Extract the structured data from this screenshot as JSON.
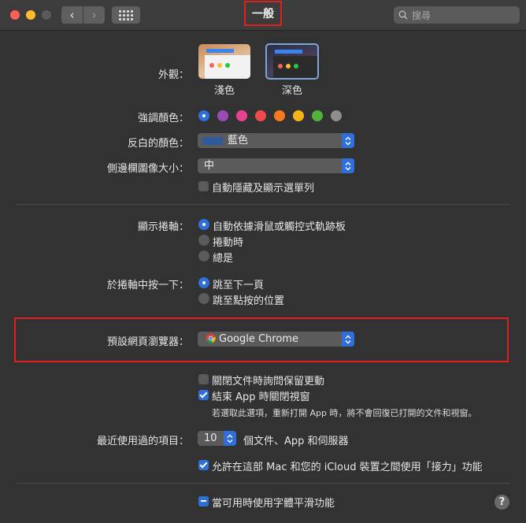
{
  "window": {
    "title": "一般",
    "search_placeholder": "搜尋"
  },
  "appearance": {
    "label": "外觀：",
    "options": [
      "淺色",
      "深色"
    ],
    "selected": "深色"
  },
  "accent": {
    "label": "強調顏色：",
    "colors": [
      "#2f6fdc",
      "#9b4bb5",
      "#e8418f",
      "#f04a4a",
      "#f57a1f",
      "#f6b21b",
      "#52b33a",
      "#8e8e8e"
    ],
    "selected_index": 0
  },
  "highlight": {
    "label": "反白的顏色：",
    "value": "藍色",
    "color": "#2f5a9a"
  },
  "sidebar_icon": {
    "label": "側邊欄圖像大小：",
    "value": "中"
  },
  "auto_hide_menu": {
    "label": "自動隱藏及顯示選單列",
    "checked": false
  },
  "scrollbars": {
    "label": "顯示捲軸：",
    "options": [
      "自動依據滑鼠或觸控式軌跡板",
      "捲動時",
      "總是"
    ],
    "selected_index": 0
  },
  "click_scroll": {
    "label": "於捲軸中按一下：",
    "options": [
      "跳至下一頁",
      "跳至點按的位置"
    ],
    "selected_index": 0
  },
  "browser": {
    "label": "預設網頁瀏覽器：",
    "value": "Google Chrome"
  },
  "ask_keep_changes": {
    "label": "關閉文件時詢問保留更動",
    "checked": false
  },
  "close_windows": {
    "label": "結束 App 時關閉視窗",
    "checked": true
  },
  "close_windows_note": "若選取此選項，重新打開 App 時，將不會回復已打開的文件和視窗。",
  "recent_items": {
    "label": "最近使用過的項目：",
    "value": "10",
    "suffix": "個文件、App 和伺服器"
  },
  "handoff": {
    "label": "允許在這部 Mac 和您的 iCloud 裝置之間使用「接力」功能",
    "checked": true
  },
  "font_smoothing": {
    "label": "當可用時使用字體平滑功能",
    "checked": true
  },
  "help": "?"
}
